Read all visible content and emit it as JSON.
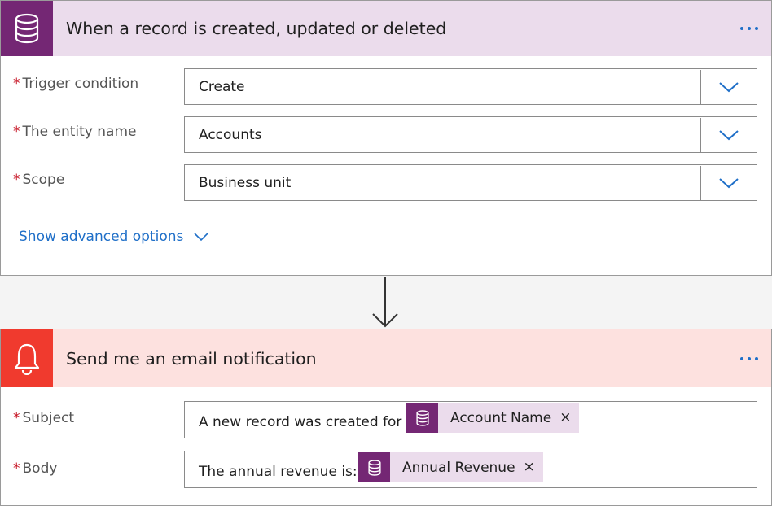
{
  "trigger": {
    "title": "When a record is created, updated or deleted",
    "icon": "database-icon",
    "fields": [
      {
        "label": "Trigger condition",
        "value": "Create"
      },
      {
        "label": "The entity name",
        "value": "Accounts"
      },
      {
        "label": "Scope",
        "value": "Business unit"
      }
    ],
    "advanced_label": "Show advanced options"
  },
  "action": {
    "title": "Send me an email notification",
    "icon": "bell-icon",
    "subject": {
      "label": "Subject",
      "text": "A new record was created for",
      "token": "Account Name"
    },
    "body": {
      "label": "Body",
      "text": "The annual revenue is:",
      "token": "Annual Revenue"
    }
  },
  "required_marker": "*",
  "token_close": "×",
  "colors": {
    "trigger_accent": "#742774",
    "trigger_header_bg": "#ebdcec",
    "action_accent": "#f03a2e",
    "action_header_bg": "#fde1df",
    "link": "#1f6fc8"
  }
}
